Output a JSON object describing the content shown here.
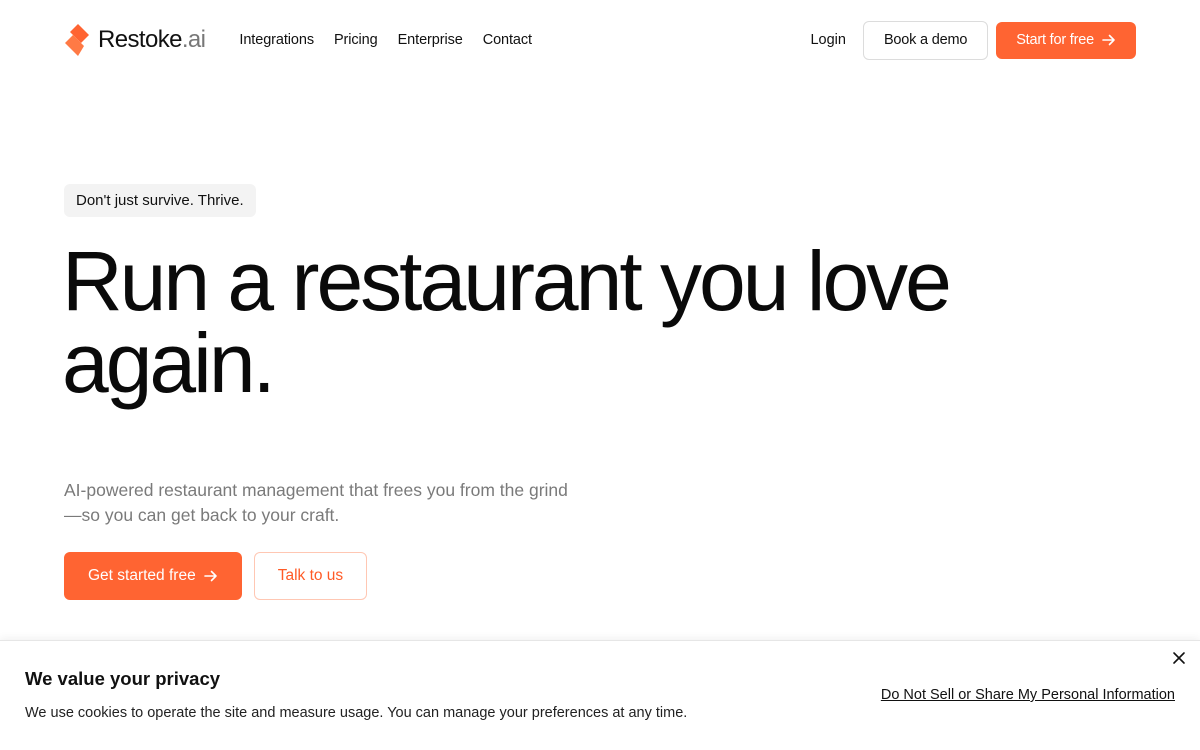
{
  "brand": {
    "name": "Restoke",
    "suffix": ".ai",
    "accent": "#ff6432"
  },
  "nav": {
    "links": [
      "Integrations",
      "Pricing",
      "Enterprise",
      "Contact"
    ],
    "login": "Login",
    "demo": "Book a demo",
    "start": "Start for free",
    "start_icon": "arrow-right-icon"
  },
  "hero": {
    "tagline": "Don't just survive. Thrive.",
    "headline_line1": "Run a restaurant you love",
    "headline_line2": "again.",
    "subtext_line1": "AI-powered restaurant management that frees you from the grind",
    "subtext_line2": "—so you can get back to your craft.",
    "cta_primary": "Get started free",
    "cta_secondary": "Talk to us"
  },
  "cookie": {
    "title": "We value your privacy",
    "text": "We use cookies to operate the site and measure usage. You can manage your preferences at any time.",
    "link": "Do Not Sell or Share My Personal Information",
    "close_icon": "close-icon"
  }
}
